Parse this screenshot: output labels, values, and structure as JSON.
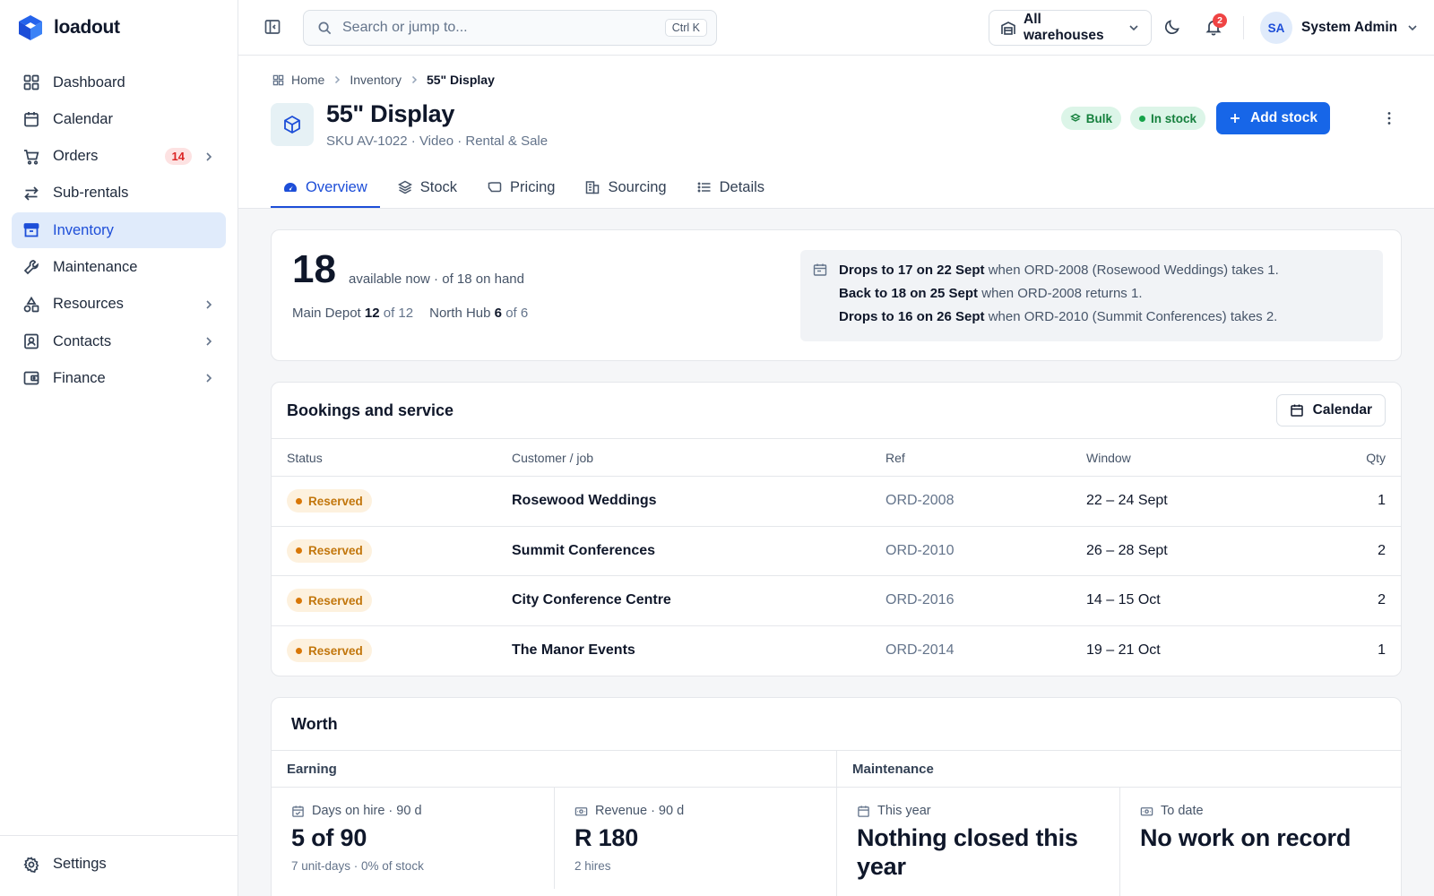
{
  "app": {
    "name": "loadout"
  },
  "sidebar": {
    "items": [
      {
        "label": "Dashboard",
        "icon": "grid-icon"
      },
      {
        "label": "Calendar",
        "icon": "calendar-icon"
      },
      {
        "label": "Orders",
        "icon": "cart-icon",
        "badge": "14"
      },
      {
        "label": "Sub-rentals",
        "icon": "swap-icon"
      },
      {
        "label": "Inventory",
        "icon": "archive-icon",
        "active": true
      },
      {
        "label": "Maintenance",
        "icon": "wrench-icon"
      },
      {
        "label": "Resources",
        "icon": "shapes-icon"
      },
      {
        "label": "Contacts",
        "icon": "contact-card-icon"
      },
      {
        "label": "Finance",
        "icon": "wallet-icon"
      }
    ],
    "settings_label": "Settings"
  },
  "topbar": {
    "search_placeholder": "Search or jump to...",
    "search_shortcut": "Ctrl K",
    "warehouse": "All warehouses",
    "notifications": "2",
    "user_initials": "SA",
    "user_name": "System Admin"
  },
  "breadcrumb": {
    "home": "Home",
    "section": "Inventory",
    "current": "55\" Display"
  },
  "item": {
    "title": "55\" Display",
    "subtitle": "SKU AV-1022 · Video · Rental & Sale",
    "tag_bulk": "Bulk",
    "tag_stock": "In stock",
    "add_stock_label": "Add stock"
  },
  "tabs": [
    {
      "label": "Overview",
      "active": true
    },
    {
      "label": "Stock"
    },
    {
      "label": "Pricing"
    },
    {
      "label": "Sourcing"
    },
    {
      "label": "Details"
    }
  ],
  "availability": {
    "available": "18",
    "text": "available now · of 18 on hand",
    "locations": [
      {
        "name": "Main Depot",
        "count": "12",
        "of": "of 12"
      },
      {
        "name": "North Hub",
        "count": "6",
        "of": "of 6"
      }
    ],
    "forecast": [
      {
        "bold": "Drops to 17 on 22 Sept",
        "rest": " when ORD-2008 (Rosewood Weddings) takes 1."
      },
      {
        "bold": "Back to 18 on 25 Sept",
        "rest": " when ORD-2008 returns 1."
      },
      {
        "bold": "Drops to 16 on 26 Sept",
        "rest": " when ORD-2010 (Summit Conferences) takes 2."
      }
    ]
  },
  "bookings": {
    "title": "Bookings and service",
    "calendar_label": "Calendar",
    "columns": {
      "status": "Status",
      "customer": "Customer / job",
      "ref": "Ref",
      "window": "Window",
      "qty": "Qty"
    },
    "rows": [
      {
        "status": "Reserved",
        "customer": "Rosewood Weddings",
        "ref": "ORD-2008",
        "window": "22 – 24 Sept",
        "qty": "1"
      },
      {
        "status": "Reserved",
        "customer": "Summit Conferences",
        "ref": "ORD-2010",
        "window": "26 – 28 Sept",
        "qty": "2"
      },
      {
        "status": "Reserved",
        "customer": "City Conference Centre",
        "ref": "ORD-2016",
        "window": "14 – 15 Oct",
        "qty": "2"
      },
      {
        "status": "Reserved",
        "customer": "The Manor Events",
        "ref": "ORD-2014",
        "window": "19 – 21 Oct",
        "qty": "1"
      }
    ]
  },
  "worth": {
    "title": "Worth",
    "earning": {
      "label": "Earning",
      "days": {
        "label": "Days on hire · 90 d",
        "value": "5 of 90",
        "note": "7 unit-days · 0% of stock"
      },
      "revenue": {
        "label": "Revenue · 90 d",
        "value": "R 180",
        "note": "2 hires"
      }
    },
    "maintenance": {
      "label": "Maintenance",
      "this_year": {
        "label": "This year",
        "value": "Nothing closed this year"
      },
      "to_date": {
        "label": "To date",
        "value": "No work on record"
      }
    }
  },
  "colors": {
    "accent": "#1766e8",
    "active_nav_bg": "#e0ebfb",
    "reserved": "#c2760c",
    "in_stock": "#15803d"
  }
}
